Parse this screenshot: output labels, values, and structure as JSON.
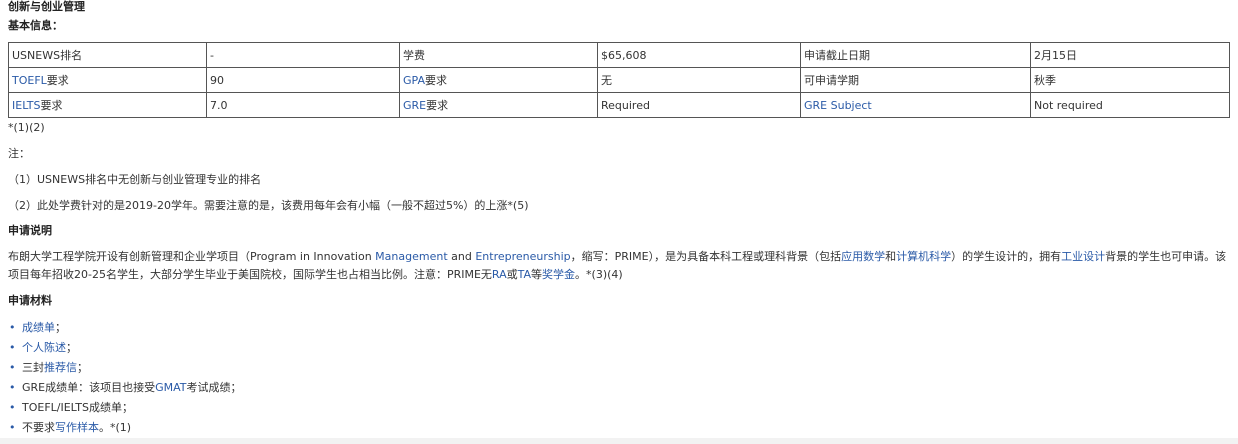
{
  "program_title": "创新与创业管理",
  "basic_info_label": "基本信息：",
  "table": {
    "rows": [
      [
        {
          "text": "USNEWS排名"
        },
        {
          "text": "-"
        },
        {
          "text": "学费"
        },
        {
          "text": "$65,608"
        },
        {
          "text": "申请截止日期"
        },
        {
          "text": "2月15日"
        }
      ],
      [
        {
          "link": "TOEFL",
          "text": "要求"
        },
        {
          "text": "90"
        },
        {
          "link": "GPA",
          "text": "要求"
        },
        {
          "text": "无"
        },
        {
          "text": "可申请学期"
        },
        {
          "text": "秋季"
        }
      ],
      [
        {
          "link": "IELTS",
          "text": "要求"
        },
        {
          "text": "7.0"
        },
        {
          "link": "GRE",
          "text": "要求"
        },
        {
          "text": "Required"
        },
        {
          "link": "GRE Subject",
          "text": ""
        },
        {
          "text": "Not required"
        }
      ]
    ]
  },
  "refs_after_table": "*(1)(2)",
  "notes": {
    "heading": "注：",
    "items": [
      "（1）USNEWS排名中无创新与创业管理专业的排名",
      "（2）此处学费针对的是2019-20学年。需要注意的是，该费用每年会有小幅（一般不超过5%）的上涨*(5)"
    ]
  },
  "application": {
    "heading": "申请说明",
    "desc": {
      "t1": "布朗大学工程学院开设有创新管理和企业学项目（Program in Innovation ",
      "l1": "Management",
      "t2": " and ",
      "l2": "Entrepreneurship",
      "t3": "，缩写：PRIME），是为具备本科工程或理科背景（包括",
      "l3": "应用数学",
      "t4": "和",
      "l4": "计算机科学",
      "t5": "）的学生设计的，拥有",
      "l5": "工业设计",
      "t6": "背景的学生也可申请。该项目每年招收20-25名学生，大部分学生毕业于美国院校，国际学生也占相当比例。注意：PRIME无",
      "l6": "RA",
      "t7": "或",
      "l7": "TA",
      "t8": "等",
      "l8": "奖学金",
      "t9": "。*(3)(4)"
    }
  },
  "materials": {
    "heading": "申请材料",
    "items": [
      {
        "pre": "",
        "link": "成绩单",
        "post": "；"
      },
      {
        "pre": "",
        "link": "个人陈述",
        "post": "；"
      },
      {
        "pre": "三封",
        "link": "推荐信",
        "post": "；"
      },
      {
        "pre": "GRE成绩单：该项目也接受",
        "link": "GMAT",
        "post": "考试成绩；"
      },
      {
        "pre": "TOEFL/IELTS成绩单；",
        "link": "",
        "post": ""
      },
      {
        "pre": "不要求",
        "link": "写作样本",
        "post": "。*(1)"
      }
    ]
  },
  "colors": {
    "link": "#2a5aa7",
    "text": "#333333",
    "border": "#555555"
  }
}
